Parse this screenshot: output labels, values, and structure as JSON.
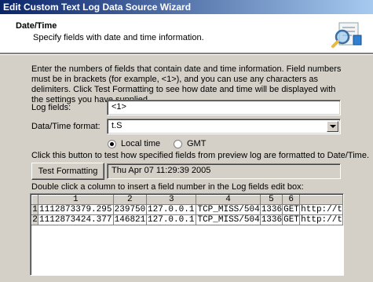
{
  "window": {
    "title": "Edit Custom Text Log Data Source Wizard"
  },
  "header": {
    "title": "Date/Time",
    "subtitle": "Specify fields with date and time information.",
    "icon": "wizard-magnifier-icon"
  },
  "instructions": "Enter the numbers of fields that contain date and time information. Field numbers must be in brackets (for example, <1>), and you can use any characters as delimiters. Click Test Formatting to see how date and time will be displayed with the settings you have supplied.",
  "form": {
    "log_fields_label": "Log fields:",
    "log_fields_value": "<1>",
    "format_label": "Data/Time format:",
    "format_value": "t.S",
    "radio_local": "Local time",
    "radio_gmt": "GMT",
    "selected_time": "local"
  },
  "test": {
    "hint": "Click this button to test how specified fields from preview log are formatted to Date/Time.",
    "button_label": "Test Formatting",
    "result": "Thu Apr 07 11:29:39 2005"
  },
  "grid": {
    "hint": "Double click a column to insert a field number in the Log fields edit box:",
    "columns": [
      "1",
      "2",
      "3",
      "4",
      "5",
      "6",
      ""
    ],
    "rows": [
      {
        "num": "1",
        "cells": [
          "1112873379.295",
          "239750",
          "127.0.0.1",
          "TCP_MISS/504",
          "1336",
          "GET",
          "http://t"
        ]
      },
      {
        "num": "2",
        "cells": [
          "1112873424.377",
          "146821",
          "127.0.0.1",
          "TCP_MISS/504",
          "1336",
          "GET",
          "http://t"
        ]
      }
    ]
  }
}
